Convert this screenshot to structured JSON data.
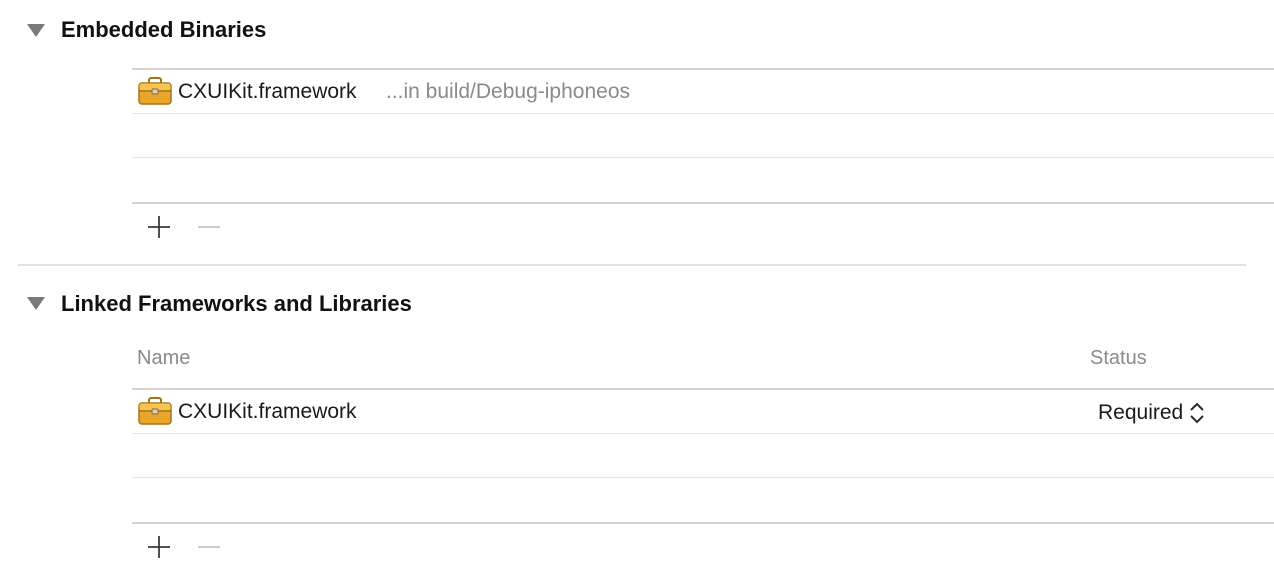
{
  "embedded": {
    "title": "Embedded Binaries",
    "items": [
      {
        "name": "CXUIKit.framework",
        "location": "...in build/Debug-iphoneos",
        "icon": "toolbox-icon"
      }
    ],
    "add_icon": "plus-icon",
    "remove_icon": "minus-icon"
  },
  "linked": {
    "title": "Linked Frameworks and Libraries",
    "columns": {
      "name": "Name",
      "status": "Status"
    },
    "items": [
      {
        "name": "CXUIKit.framework",
        "status": "Required",
        "icon": "toolbox-icon"
      }
    ],
    "add_icon": "plus-icon",
    "remove_icon": "minus-icon"
  },
  "colors": {
    "icon_body": "#e8a72a",
    "icon_top": "#f6c453",
    "icon_outline": "#a8741a",
    "disclosure": "#7a7a7a",
    "secondary_text": "#8a8a8a"
  }
}
